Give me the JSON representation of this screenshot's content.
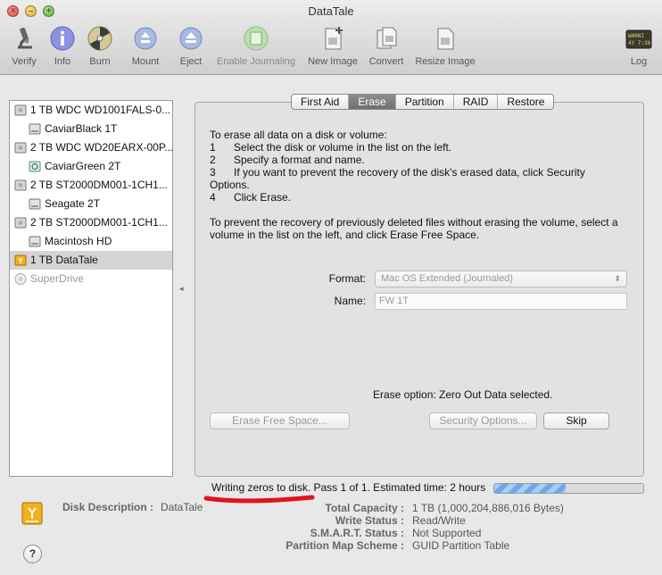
{
  "window": {
    "title": "DataTale"
  },
  "toolbar": {
    "items": [
      {
        "label": "Verify",
        "icon": "microscope-icon",
        "enabled": true
      },
      {
        "label": "Info",
        "icon": "info-icon",
        "enabled": true
      },
      {
        "label": "Burn",
        "icon": "burn-disc-icon",
        "enabled": true
      },
      {
        "label": "Mount",
        "icon": "mount-icon",
        "enabled": true
      },
      {
        "label": "Eject",
        "icon": "eject-icon",
        "enabled": true
      },
      {
        "label": "Enable Journaling",
        "icon": "journal-icon",
        "enabled": false
      },
      {
        "label": "New Image",
        "icon": "new-image-icon",
        "enabled": true
      },
      {
        "label": "Convert",
        "icon": "convert-icon",
        "enabled": true
      },
      {
        "label": "Resize Image",
        "icon": "resize-image-icon",
        "enabled": true
      },
      {
        "label": "Log",
        "icon": "log-icon",
        "enabled": true
      }
    ],
    "log_badge": "WARNI\n4Y 7:36"
  },
  "sidebar": {
    "items": [
      {
        "label": "1 TB WDC WD1001FALS-0...",
        "level": 0,
        "icon": "drive-icon",
        "selected": false,
        "dim": false
      },
      {
        "label": "CaviarBlack 1T",
        "level": 1,
        "icon": "volume-icon",
        "selected": false,
        "dim": false
      },
      {
        "label": "2 TB WDC WD20EARX-00P...",
        "level": 0,
        "icon": "drive-icon",
        "selected": false,
        "dim": false
      },
      {
        "label": "CaviarGreen 2T",
        "level": 1,
        "icon": "time-machine-volume-icon",
        "selected": false,
        "dim": false
      },
      {
        "label": "2 TB ST2000DM001-1CH1...",
        "level": 0,
        "icon": "drive-icon",
        "selected": false,
        "dim": false
      },
      {
        "label": "Seagate 2T",
        "level": 1,
        "icon": "volume-icon",
        "selected": false,
        "dim": false
      },
      {
        "label": "2 TB ST2000DM001-1CH1...",
        "level": 0,
        "icon": "drive-icon",
        "selected": false,
        "dim": false
      },
      {
        "label": "Macintosh HD",
        "level": 1,
        "icon": "volume-icon",
        "selected": false,
        "dim": false
      },
      {
        "label": "1 TB DataTale",
        "level": 0,
        "icon": "external-drive-icon",
        "selected": true,
        "dim": false
      },
      {
        "label": "SuperDrive",
        "level": 0,
        "icon": "optical-drive-icon",
        "selected": false,
        "dim": true
      }
    ]
  },
  "tabs": [
    {
      "label": "First Aid",
      "active": false
    },
    {
      "label": "Erase",
      "active": true
    },
    {
      "label": "Partition",
      "active": false
    },
    {
      "label": "RAID",
      "active": false
    },
    {
      "label": "Restore",
      "active": false
    }
  ],
  "erase": {
    "intro": "To erase all data on a disk or volume:",
    "steps": [
      {
        "num": "1",
        "text": "Select the disk or volume in the list on the left."
      },
      {
        "num": "2",
        "text": "Specify a format and name."
      },
      {
        "num": "3",
        "text": "If you want to prevent the recovery of the disk's erased data, click Security"
      },
      {
        "num": "",
        "text": "Options."
      },
      {
        "num": "4",
        "text": "Click Erase."
      }
    ],
    "free_space_line1": "To prevent the recovery of previously deleted files without erasing the volume, select a",
    "free_space_line2": "volume in the list on the left, and click Erase Free Space.",
    "format_label": "Format:",
    "format_value": "Mac OS Extended (Journaled)",
    "name_label": "Name:",
    "name_value": "FW 1T",
    "erase_option": "Erase option: Zero Out Data selected.",
    "erase_free_space_button": "Erase Free Space...",
    "security_options_button": "Security Options...",
    "skip_button": "Skip"
  },
  "progress": {
    "text": "Writing zeros to disk. Pass 1 of 1. Estimated time: 2 hours",
    "fraction": 0.48
  },
  "footer": {
    "disk_description_label": "Disk Description :",
    "disk_description_value": "DataTale",
    "rows": [
      {
        "key": "Total Capacity :",
        "value": "1 TB (1,000,204,886,016 Bytes)"
      },
      {
        "key": "Write Status :",
        "value": "Read/Write"
      },
      {
        "key": "S.M.A.R.T. Status :",
        "value": "Not Supported"
      },
      {
        "key": "Partition Map Scheme :",
        "value": "GUID Partition Table"
      }
    ],
    "help": "?"
  },
  "colors": {
    "selection": "#d4d4d4",
    "progress": "#6ea8e8",
    "annotation": "#e0131a",
    "active_tab": "#7a7a7a"
  }
}
